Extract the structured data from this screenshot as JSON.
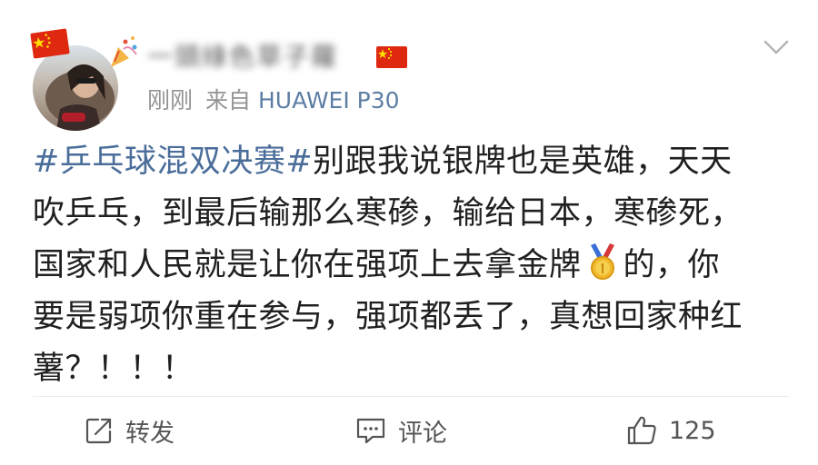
{
  "post": {
    "username_obscured": "一頭綠色草子蘿",
    "timestamp": "刚刚",
    "source_prefix": "来自",
    "device": "HUAWEI P30",
    "hashtag": "#乒乓球混双决赛#",
    "line1_rest": "别跟我说银牌也是英雄，天天",
    "line2": "吹乒乓，到最后输那么寒碜，输给日本，寒碜死，",
    "line3_a": "国家和人民就是让你在强项上去拿金牌",
    "line3_b": "的，你",
    "line4": "要是弱项你重在参与，强项都丢了，真想回家种红",
    "line5": "薯？！！！"
  },
  "actions": {
    "repost_label": "转发",
    "comment_label": "评论",
    "like_count": "125"
  },
  "colors": {
    "hashtag": "#4a6d9a",
    "device": "#5d7ea4",
    "meta": "#939393",
    "flag_red": "#de2910",
    "flag_yellow": "#ffde00"
  },
  "icons": {
    "header": [
      "china-flag-icon",
      "party-popper-icon",
      "chevron-down-icon"
    ],
    "inline": [
      "gold-medal-icon"
    ],
    "actions": [
      "repost-icon",
      "comment-icon",
      "thumbs-up-icon"
    ]
  }
}
